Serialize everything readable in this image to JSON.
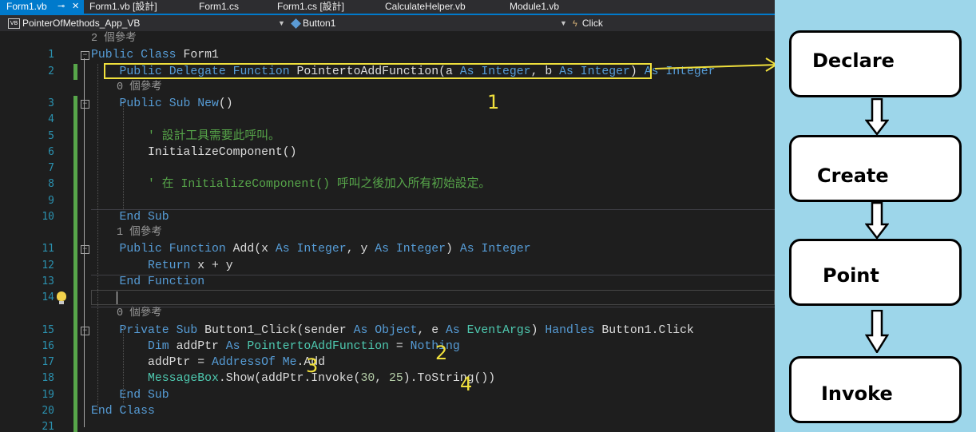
{
  "tabs": [
    {
      "label": "Form1.vb",
      "active": true
    },
    {
      "label": "Form1.vb [設計]",
      "active": false
    },
    {
      "label": "Form1.cs",
      "active": false
    },
    {
      "label": "Form1.cs [設計]",
      "active": false
    },
    {
      "label": "CalculateHelper.vb",
      "active": false
    },
    {
      "label": "Module1.vb",
      "active": false
    }
  ],
  "tab_controls": {
    "pin_icon": "pin-icon",
    "close_icon": "close-icon"
  },
  "navbar": {
    "project_icon_text": "VB",
    "project": "PointerOfMethods_App_VB",
    "object": "Button1",
    "member": "Click"
  },
  "editor": {
    "lens_top": "2 個參考",
    "lines": [
      {
        "n": "1",
        "segs": [
          [
            "kw",
            "Public Class "
          ],
          [
            "",
            "Form1"
          ]
        ]
      },
      {
        "n": "2",
        "segs": [
          [
            "",
            "    "
          ],
          [
            "kw",
            "Public Delegate Function "
          ],
          [
            "",
            "PointertoAddFunction(a "
          ],
          [
            "kw",
            "As "
          ],
          [
            "kw",
            "Integer"
          ],
          [
            "",
            ", b "
          ],
          [
            "kw",
            "As "
          ],
          [
            "kw",
            "Integer"
          ],
          [
            "",
            ") "
          ],
          [
            "kw",
            "As "
          ],
          [
            "kw",
            "Integer"
          ]
        ]
      },
      {
        "lens": "0 個參考"
      },
      {
        "n": "3",
        "segs": [
          [
            "",
            "    "
          ],
          [
            "kw",
            "Public Sub "
          ],
          [
            "kw",
            "New"
          ],
          [
            "",
            "()"
          ]
        ]
      },
      {
        "n": "4",
        "segs": []
      },
      {
        "n": "5",
        "segs": [
          [
            "",
            "        "
          ],
          [
            "cm",
            "' 設計工具需要此呼叫。"
          ]
        ]
      },
      {
        "n": "6",
        "segs": [
          [
            "",
            "        InitializeComponent()"
          ]
        ]
      },
      {
        "n": "7",
        "segs": []
      },
      {
        "n": "8",
        "segs": [
          [
            "",
            "        "
          ],
          [
            "cm",
            "' 在 InitializeComponent() 呼叫之後加入所有初始設定。"
          ]
        ]
      },
      {
        "n": "9",
        "segs": []
      },
      {
        "n": "10",
        "segs": [
          [
            "",
            "    "
          ],
          [
            "kw",
            "End Sub"
          ]
        ]
      },
      {
        "lens": "1 個參考"
      },
      {
        "n": "11",
        "segs": [
          [
            "",
            "    "
          ],
          [
            "kw",
            "Public Function "
          ],
          [
            "",
            "Add(x "
          ],
          [
            "kw",
            "As "
          ],
          [
            "kw",
            "Integer"
          ],
          [
            "",
            ", y "
          ],
          [
            "kw",
            "As "
          ],
          [
            "kw",
            "Integer"
          ],
          [
            "",
            ") "
          ],
          [
            "kw",
            "As "
          ],
          [
            "kw",
            "Integer"
          ]
        ]
      },
      {
        "n": "12",
        "segs": [
          [
            "",
            "        "
          ],
          [
            "kw",
            "Return "
          ],
          [
            "",
            "x + y"
          ]
        ]
      },
      {
        "n": "13",
        "segs": [
          [
            "",
            "    "
          ],
          [
            "kw",
            "End Function"
          ]
        ]
      },
      {
        "n": "14",
        "segs": []
      },
      {
        "lens": "0 個參考"
      },
      {
        "n": "15",
        "segs": [
          [
            "",
            "    "
          ],
          [
            "kw",
            "Private Sub "
          ],
          [
            "",
            "Button1_Click(sender "
          ],
          [
            "kw",
            "As "
          ],
          [
            "kw",
            "Object"
          ],
          [
            "",
            ", e "
          ],
          [
            "kw",
            "As "
          ],
          [
            "ty",
            "EventArgs"
          ],
          [
            "",
            ") "
          ],
          [
            "kw",
            "Handles "
          ],
          [
            "",
            "Button1.Click"
          ]
        ]
      },
      {
        "n": "16",
        "segs": [
          [
            "",
            "        "
          ],
          [
            "kw",
            "Dim "
          ],
          [
            "",
            "addPtr "
          ],
          [
            "kw",
            "As "
          ],
          [
            "ty",
            "PointertoAddFunction"
          ],
          [
            "",
            " = "
          ],
          [
            "kw",
            "Nothing"
          ]
        ]
      },
      {
        "n": "17",
        "segs": [
          [
            "",
            "        addPtr = "
          ],
          [
            "kw",
            "AddressOf "
          ],
          [
            "kw",
            "Me"
          ],
          [
            "",
            ".Add"
          ]
        ]
      },
      {
        "n": "18",
        "segs": [
          [
            "",
            "        "
          ],
          [
            "ty",
            "MessageBox"
          ],
          [
            "",
            ".Show(addPtr.Invoke("
          ],
          [
            "num",
            "30"
          ],
          [
            "",
            ", "
          ],
          [
            "num",
            "25"
          ],
          [
            "",
            ").ToString())"
          ]
        ]
      },
      {
        "n": "19",
        "segs": [
          [
            "",
            "    "
          ],
          [
            "kw",
            "End Sub"
          ]
        ]
      },
      {
        "n": "20",
        "segs": [
          [
            "kw",
            "End Class"
          ]
        ]
      },
      {
        "n": "21",
        "segs": []
      }
    ]
  },
  "annotations": {
    "one": "1",
    "two": "2",
    "three": "3",
    "four": "4"
  },
  "flow": {
    "steps": [
      "Declare",
      "Create",
      "Point",
      "Invoke"
    ],
    "box_color": "#ffffff",
    "panel_color": "#9dd6ea"
  },
  "colors": {
    "accent": "#007acc",
    "highlight": "#f0e03c",
    "keyword": "#569cd6",
    "type": "#4ec9b0",
    "comment": "#57a64a"
  },
  "icons": {
    "lightbulb": "lightbulb-icon",
    "vb_file": "vb-file-icon",
    "cube": "cube-icon",
    "event": "lightning-icon"
  }
}
